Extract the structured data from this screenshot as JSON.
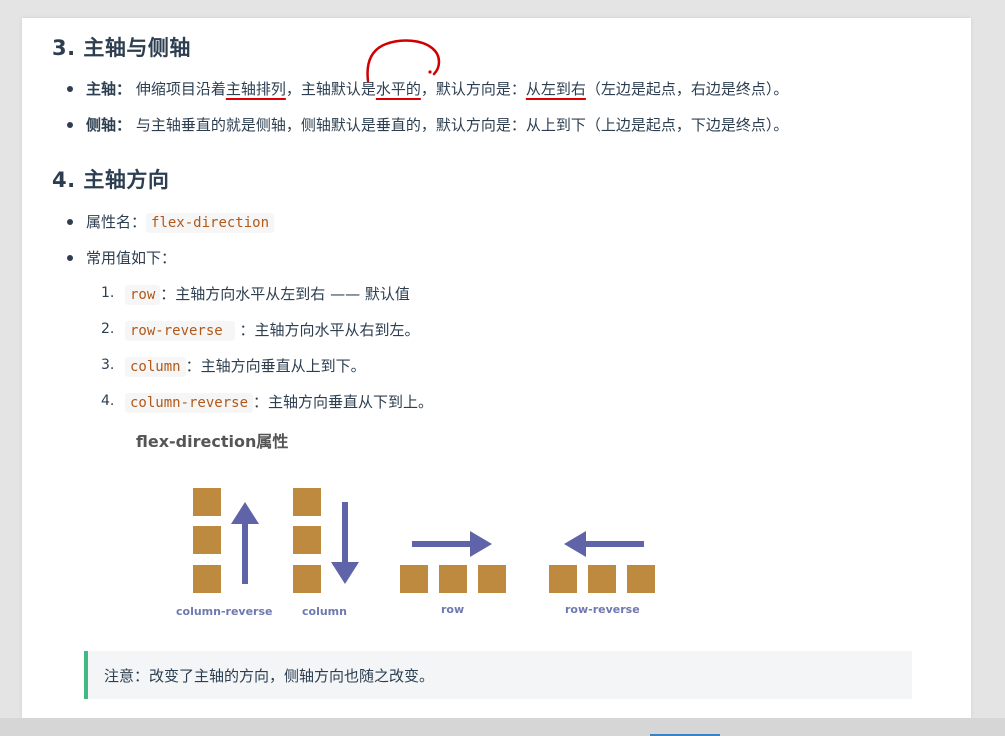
{
  "section3": {
    "title": "3. 主轴与侧轴",
    "items": [
      {
        "label": "主轴",
        "colon": "：",
        "pre": "伸缩项目沿着",
        "u1": "主轴排列",
        "mid1": "，主轴默认是",
        "u2": "水平的",
        "mid2": "，默认方向是：",
        "u3": "从左到右",
        "post": "（左边是起点，右边是终点）。"
      },
      {
        "label": "侧轴",
        "colon": "：",
        "text": "与主轴垂直的就是侧轴，侧轴默认是垂直的，默认方向是：从上到下（上边是起点，下边是终点）。"
      }
    ]
  },
  "section4": {
    "title": "4. 主轴方向",
    "prop_label": "属性名：",
    "prop_code": "flex-direction",
    "common_label": "常用值如下：",
    "values": [
      {
        "num": "1.",
        "code": "row",
        "desc": "：主轴方向水平从左到右 —— 默认值"
      },
      {
        "num": "2.",
        "code": "row-reverse",
        "desc": "：主轴方向水平从右到左。"
      },
      {
        "num": "3.",
        "code": "column",
        "desc": "：主轴方向垂直从上到下。"
      },
      {
        "num": "4.",
        "code": "column-reverse",
        "desc": "：主轴方向垂直从下到上。"
      }
    ]
  },
  "figure": {
    "title": "flex-direction属性",
    "labels": [
      "column-reverse",
      "column",
      "row",
      "row-reverse"
    ],
    "colors": {
      "box": "#bd8a3f",
      "arrow": "#5f63a8",
      "label": "#6f78b0"
    }
  },
  "note": {
    "text": "注意：改变了主轴的方向，侧轴方向也随之改变。"
  },
  "theme": {
    "accent_border": "#42b983",
    "code_color": "#b1581a",
    "annotation_ink": "#d00000"
  }
}
